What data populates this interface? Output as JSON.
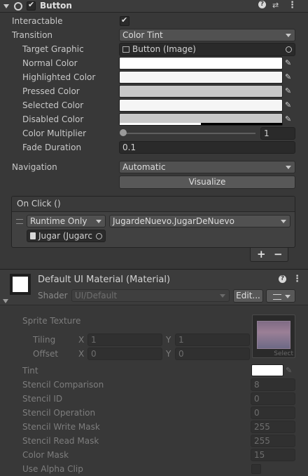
{
  "component": {
    "title": "Button",
    "interactable_label": "Interactable",
    "interactable_checked": true,
    "transition_label": "Transition",
    "transition_value": "Color Tint",
    "target_graphic_label": "Target Graphic",
    "target_graphic_value": "Button (Image)",
    "normal_color_label": "Normal Color",
    "highlighted_color_label": "Highlighted Color",
    "pressed_color_label": "Pressed Color",
    "selected_color_label": "Selected Color",
    "disabled_color_label": "Disabled Color",
    "color_multiplier_label": "Color Multiplier",
    "color_multiplier_value": "1",
    "color_multiplier_slider_fraction": 0,
    "fade_duration_label": "Fade Duration",
    "fade_duration_value": "0.1",
    "navigation_label": "Navigation",
    "navigation_value": "Automatic",
    "visualize_label": "Visualize"
  },
  "colors": {
    "normal": "#ffffff",
    "highlighted": "#f5f5f5",
    "pressed": "#c8c8c8",
    "selected": "#f5f5f5",
    "disabled": "#c8c8c8",
    "accent_text": "#c8c8c8"
  },
  "on_click": {
    "header": "On Click ()",
    "runtime_value": "Runtime Only",
    "function_value": "JugardeNuevo.JugarDeNuevo",
    "object_value": "Jugar  (Jugarc",
    "add_label": "+",
    "remove_label": "−"
  },
  "material": {
    "title": "Default UI Material (Material)",
    "shader_label": "Shader",
    "shader_value": "UI/Default",
    "edit_label": "Edit...",
    "sprite_texture_label": "Sprite Texture",
    "tiling_label": "Tiling",
    "offset_label": "Offset",
    "x_label": "X",
    "y_label": "Y",
    "tiling_x": "1",
    "tiling_y": "1",
    "offset_x": "0",
    "offset_y": "0",
    "select_label": "Select",
    "tint_label": "Tint",
    "tint_color": "#ffffff",
    "properties": [
      {
        "label": "Stencil Comparison",
        "value": "8"
      },
      {
        "label": "Stencil ID",
        "value": "0"
      },
      {
        "label": "Stencil Operation",
        "value": "0"
      },
      {
        "label": "Stencil Write Mask",
        "value": "255"
      },
      {
        "label": "Stencil Read Mask",
        "value": "255"
      },
      {
        "label": "Color Mask",
        "value": "15"
      }
    ],
    "use_alpha_clip_label": "Use Alpha Clip"
  },
  "icons": [
    "foldout-arrow-icon",
    "component-radio-icon",
    "enabled-checkbox-icon",
    "help-icon",
    "preset-icon",
    "kebab-menu-icon",
    "image-object-icon",
    "object-picker-icon",
    "eyedropper-icon",
    "drag-handle-icon",
    "script-object-icon",
    "layers-icon"
  ]
}
